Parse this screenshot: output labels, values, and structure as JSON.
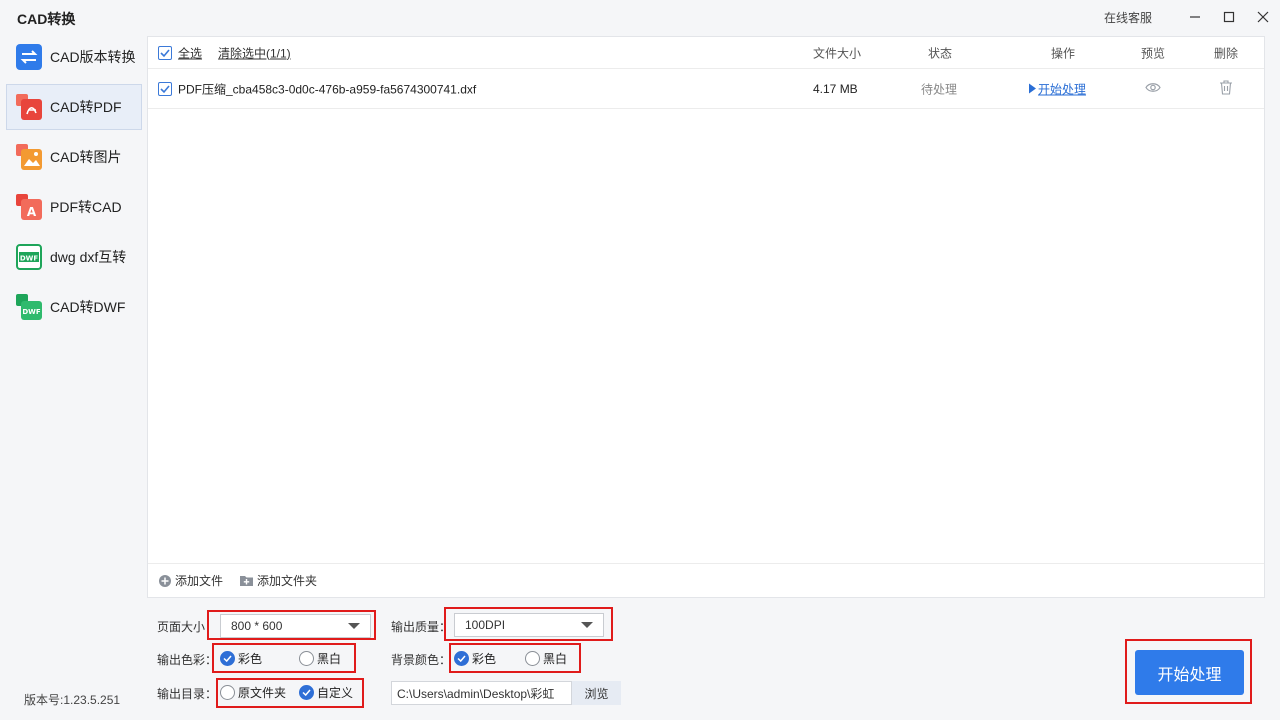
{
  "app": {
    "title": "CAD转换",
    "service_label": "在线客服",
    "version": "版本号:1.23.5.251"
  },
  "sidebar": {
    "items": [
      {
        "label": "CAD版本转换",
        "icon": "cad-version-convert-icon"
      },
      {
        "label": "CAD转PDF",
        "icon": "cad-to-pdf-icon"
      },
      {
        "label": "CAD转图片",
        "icon": "cad-to-image-icon"
      },
      {
        "label": "PDF转CAD",
        "icon": "pdf-to-cad-icon"
      },
      {
        "label": "dwg dxf互转",
        "icon": "dwg-dxf-icon"
      },
      {
        "label": "CAD转DWF",
        "icon": "cad-to-dwf-icon"
      }
    ],
    "active_index": 1
  },
  "file_list": {
    "select_all": "全选",
    "clear_selected": "清除选中(1/1)",
    "columns": {
      "size": "文件大小",
      "status": "状态",
      "action": "操作",
      "preview": "预览",
      "delete": "删除"
    },
    "rows": [
      {
        "name": "PDF压缩_cba458c3-0d0c-476b-a959-fa5674300741.dxf",
        "size": "4.17 MB",
        "status": "待处理",
        "action": "开始处理",
        "checked": true
      }
    ],
    "add_file": "添加文件",
    "add_folder": "添加文件夹"
  },
  "settings": {
    "page_size_label": "页面大小：",
    "page_size_value": "800 * 600",
    "quality_label": "输出质量：",
    "quality_value": "100DPI",
    "color_label": "输出色彩：",
    "color_options": [
      "彩色",
      "黑白"
    ],
    "color_selected": "彩色",
    "bg_label": "背景颜色：",
    "bg_options": [
      "彩色",
      "黑白"
    ],
    "bg_selected": "彩色",
    "output_dir_label": "输出目录：",
    "output_dir_options": [
      "原文件夹",
      "自定义"
    ],
    "output_dir_selected": "自定义",
    "output_path": "C:\\Users\\admin\\Desktop\\彩虹",
    "browse_label": "浏览"
  },
  "start_button": "开始处理",
  "colors": {
    "accent": "#2f7bea",
    "highlight_box": "#e01b1b",
    "active_bg": "#e8eef8"
  }
}
